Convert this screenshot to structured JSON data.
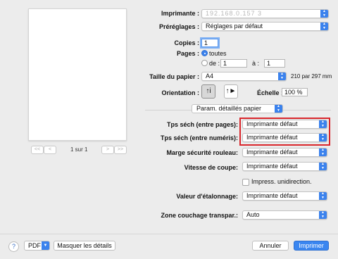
{
  "preview": {
    "page_indicator": "1 sur 1",
    "nav": {
      "first": "<<",
      "prev": "<",
      "next": ">",
      "last": ">>"
    }
  },
  "printer": {
    "label": "Imprimante :",
    "value": "192.168.0.157 3"
  },
  "presets": {
    "label": "Préréglages :",
    "value": "Réglages par défaut"
  },
  "copies": {
    "label": "Copies :",
    "value": "1"
  },
  "pages": {
    "label": "Pages :",
    "all_label": "toutes",
    "from_label": "de :",
    "from_value": "1",
    "to_label": "à :",
    "to_value": "1",
    "selected": "toutes"
  },
  "paper_size": {
    "label": "Taille du papier :",
    "value": "A4",
    "dimensions": "210 par 297 mm"
  },
  "orientation": {
    "label": "Orientation :",
    "portrait_glyph": "↑i",
    "landscape_glyph": "↑►",
    "selected": "portrait"
  },
  "scale": {
    "label": "Échelle :",
    "value": "100 %"
  },
  "section": {
    "value": "Param. détaillés papier"
  },
  "settings": {
    "drying_pages": {
      "label": "Tps séch (entre pages):",
      "value": "Imprimante défaut"
    },
    "drying_scans": {
      "label": "Tps séch (entre numéris):",
      "value": "Imprimante défaut"
    },
    "roll_margin": {
      "label": "Marge sécurité rouleau:",
      "value": "Imprimante défaut"
    },
    "cut_speed": {
      "label": "Vitesse de coupe:",
      "value": "Imprimante défaut"
    },
    "unidirectional": {
      "label": "Impress. unidirection.",
      "checked": false
    },
    "calibration": {
      "label": "Valeur d'étalonnage:",
      "value": "Imprimante défaut"
    },
    "coating_zone": {
      "label": "Zone couchage transpar.:",
      "value": "Auto"
    }
  },
  "footer": {
    "help": "?",
    "pdf": "PDF",
    "hide_details": "Masquer les détails",
    "cancel": "Annuler",
    "print": "Imprimer"
  },
  "colors": {
    "accent": "#3b82ed",
    "highlight": "#d9262b",
    "background": "#ececec"
  },
  "icons": {
    "stepper": "chevron-up-down-icon",
    "help": "question-icon",
    "dropdown": "chevron-down-icon"
  }
}
